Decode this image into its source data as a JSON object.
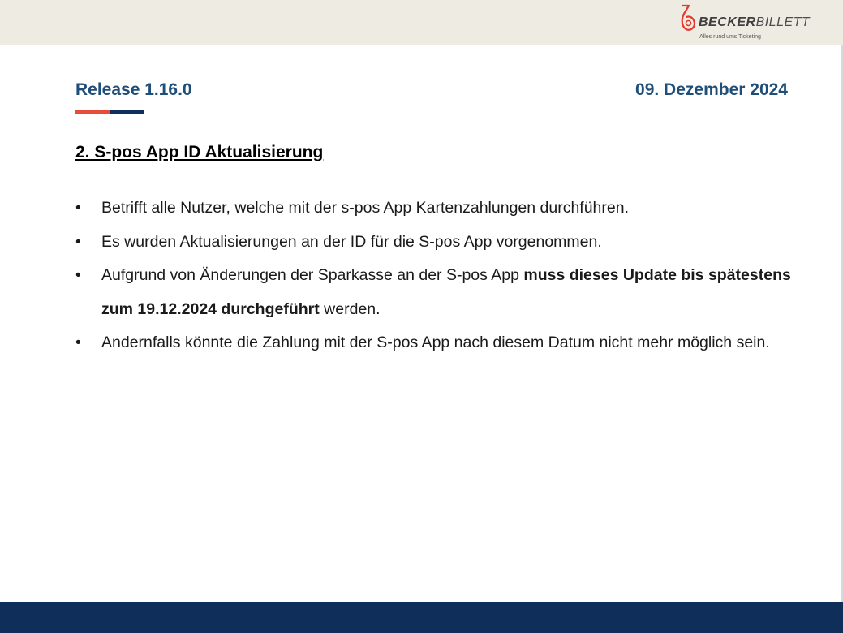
{
  "header": {
    "logo": {
      "name_part1": "BECKER",
      "name_part2": "BILLETT",
      "tagline": "Alles rund ums Ticketing"
    }
  },
  "title_row": {
    "release": "Release 1.16.0",
    "date": "09. Dezember 2024"
  },
  "section": {
    "heading": "2. S-pos App ID Aktualisierung"
  },
  "bullets": [
    {
      "text": "Betrifft alle Nutzer, welche mit der s-pos App Kartenzahlungen durchführen."
    },
    {
      "text": "Es wurden Aktualisierungen an der ID für die S-pos App vorgenommen."
    },
    {
      "text_before": "Aufgrund von Änderungen der Sparkasse an der S-pos App ",
      "text_bold": "muss dieses Update bis spätestens zum 19.12.2024 durchgeführt",
      "text_after": " werden."
    },
    {
      "text": "Andernfalls könnte die Zahlung mit der S-pos App nach diesem Datum nicht mehr möglich sein."
    }
  ],
  "bullet_symbol": "•",
  "colors": {
    "title_blue": "#1f4e79",
    "accent_red": "#e74c3c",
    "accent_navy": "#0f2e5a",
    "top_band": "#eeebe2",
    "footer_band": "#0f2e5a"
  }
}
